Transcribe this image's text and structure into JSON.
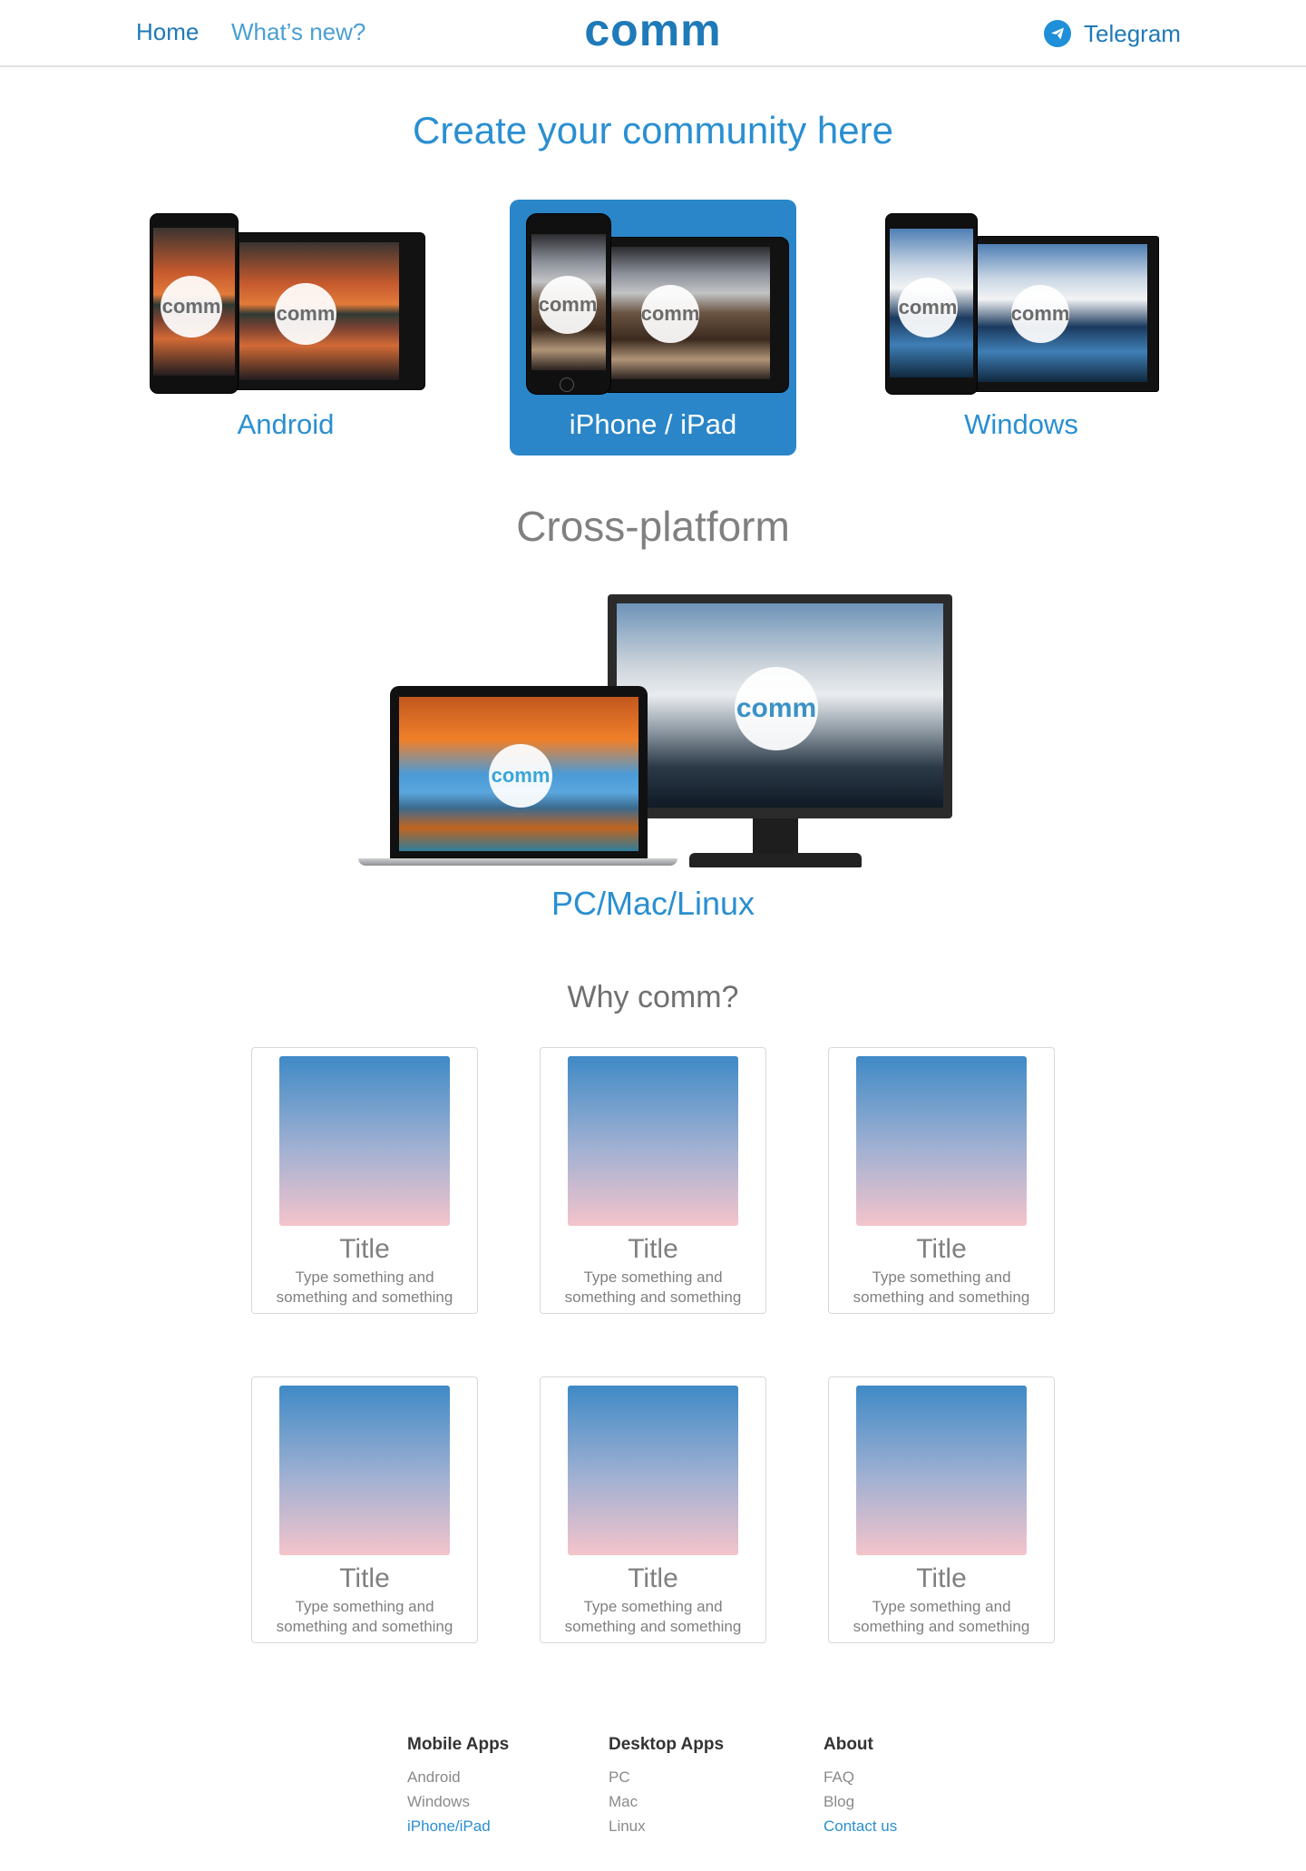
{
  "colors": {
    "brand": "#1e7ab8",
    "accent_blue": "#2a8fd1",
    "active_tile": "#2a86c8",
    "card_gradient_top": "#3f8ac6",
    "card_gradient_bottom": "#f4c4cb"
  },
  "header": {
    "home_label": "Home",
    "whats_new_label": "What’s new?",
    "logo_text": "comm",
    "telegram_label": "Telegram",
    "telegram_icon": "paper-plane-icon"
  },
  "hero": {
    "title": "Create your community here"
  },
  "platforms": [
    {
      "label": "Android",
      "logo_text": "comm",
      "active": false
    },
    {
      "label": "iPhone / iPad",
      "logo_text": "comm",
      "active": true
    },
    {
      "label": "Windows",
      "logo_text": "comm",
      "active": false
    }
  ],
  "cross_platform": {
    "title": "Cross-platform",
    "label": "PC/Mac/Linux",
    "logo_text": "comm"
  },
  "why": {
    "title": "Why comm?",
    "cards": [
      {
        "title": "Title",
        "text": "Type something and something and something"
      },
      {
        "title": "Title",
        "text": "Type something and something and something"
      },
      {
        "title": "Title",
        "text": "Type something and something and something"
      },
      {
        "title": "Title",
        "text": "Type something and something and something"
      },
      {
        "title": "Title",
        "text": "Type something and something and something"
      },
      {
        "title": "Title",
        "text": "Type something and something and something"
      }
    ]
  },
  "footer": {
    "columns": [
      {
        "heading": "Mobile Apps",
        "links": [
          "Android",
          "Windows",
          "iPhone/iPad"
        ]
      },
      {
        "heading": "Desktop Apps",
        "links": [
          "PC",
          "Mac",
          "Linux"
        ]
      },
      {
        "heading": "About",
        "links": [
          "FAQ",
          "Blog",
          "Contact us"
        ]
      }
    ]
  }
}
